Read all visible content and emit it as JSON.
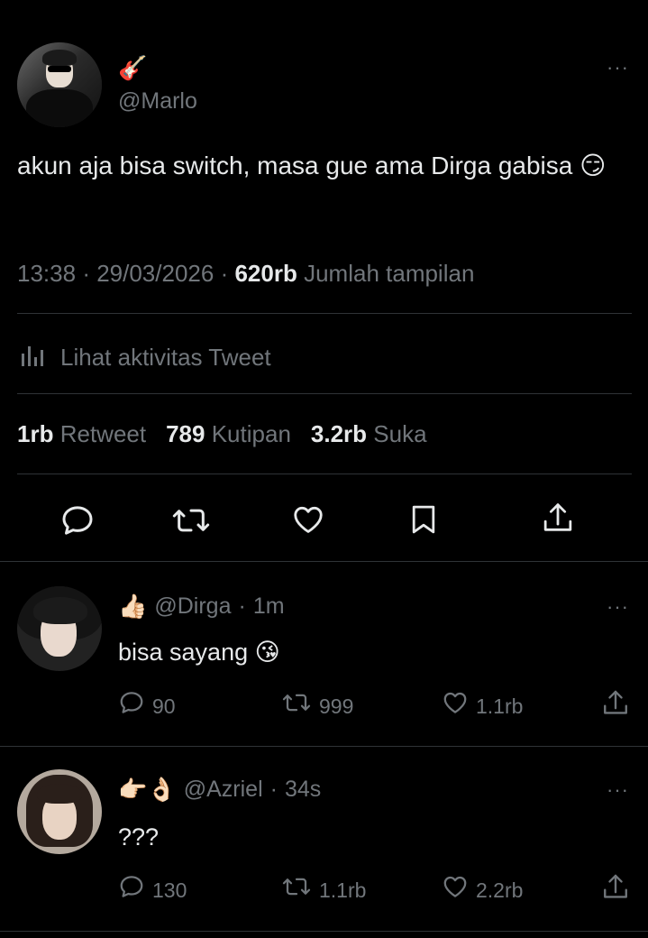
{
  "main_tweet": {
    "author_emoji": "🎸",
    "handle": "@Marlo",
    "more_label": "···",
    "text": "akun aja bisa switch, masa gue ama Dirga gabisa 😏",
    "time": "13:38",
    "date": "29/03/2026",
    "views_count": "620rb",
    "views_label": "Jumlah tampilan",
    "activity_label": "Lihat aktivitas Tweet",
    "stats": {
      "retweets_count": "1rb",
      "retweets_label": "Retweet",
      "quotes_count": "789",
      "quotes_label": "Kutipan",
      "likes_count": "3.2rb",
      "likes_label": "Suka"
    },
    "icons": [
      "reply-icon",
      "retweet-icon",
      "like-icon",
      "bookmark-icon",
      "share-icon"
    ]
  },
  "replies": [
    {
      "emoji": "👍🏻",
      "handle": "@Dirga",
      "time": "1m",
      "text": "bisa sayang 😘",
      "reply_count": "90",
      "retweet_count": "999",
      "like_count": "1.1rb"
    },
    {
      "emoji": "👉🏻👌🏻",
      "handle": "@Azriel",
      "time": "34s",
      "text": "???",
      "reply_count": "130",
      "retweet_count": "1.1rb",
      "like_count": "2.2rb"
    }
  ],
  "colors": {
    "background": "#000000",
    "text_primary": "#e7e9ea",
    "text_secondary": "#71767b",
    "divider": "#2f3336"
  }
}
